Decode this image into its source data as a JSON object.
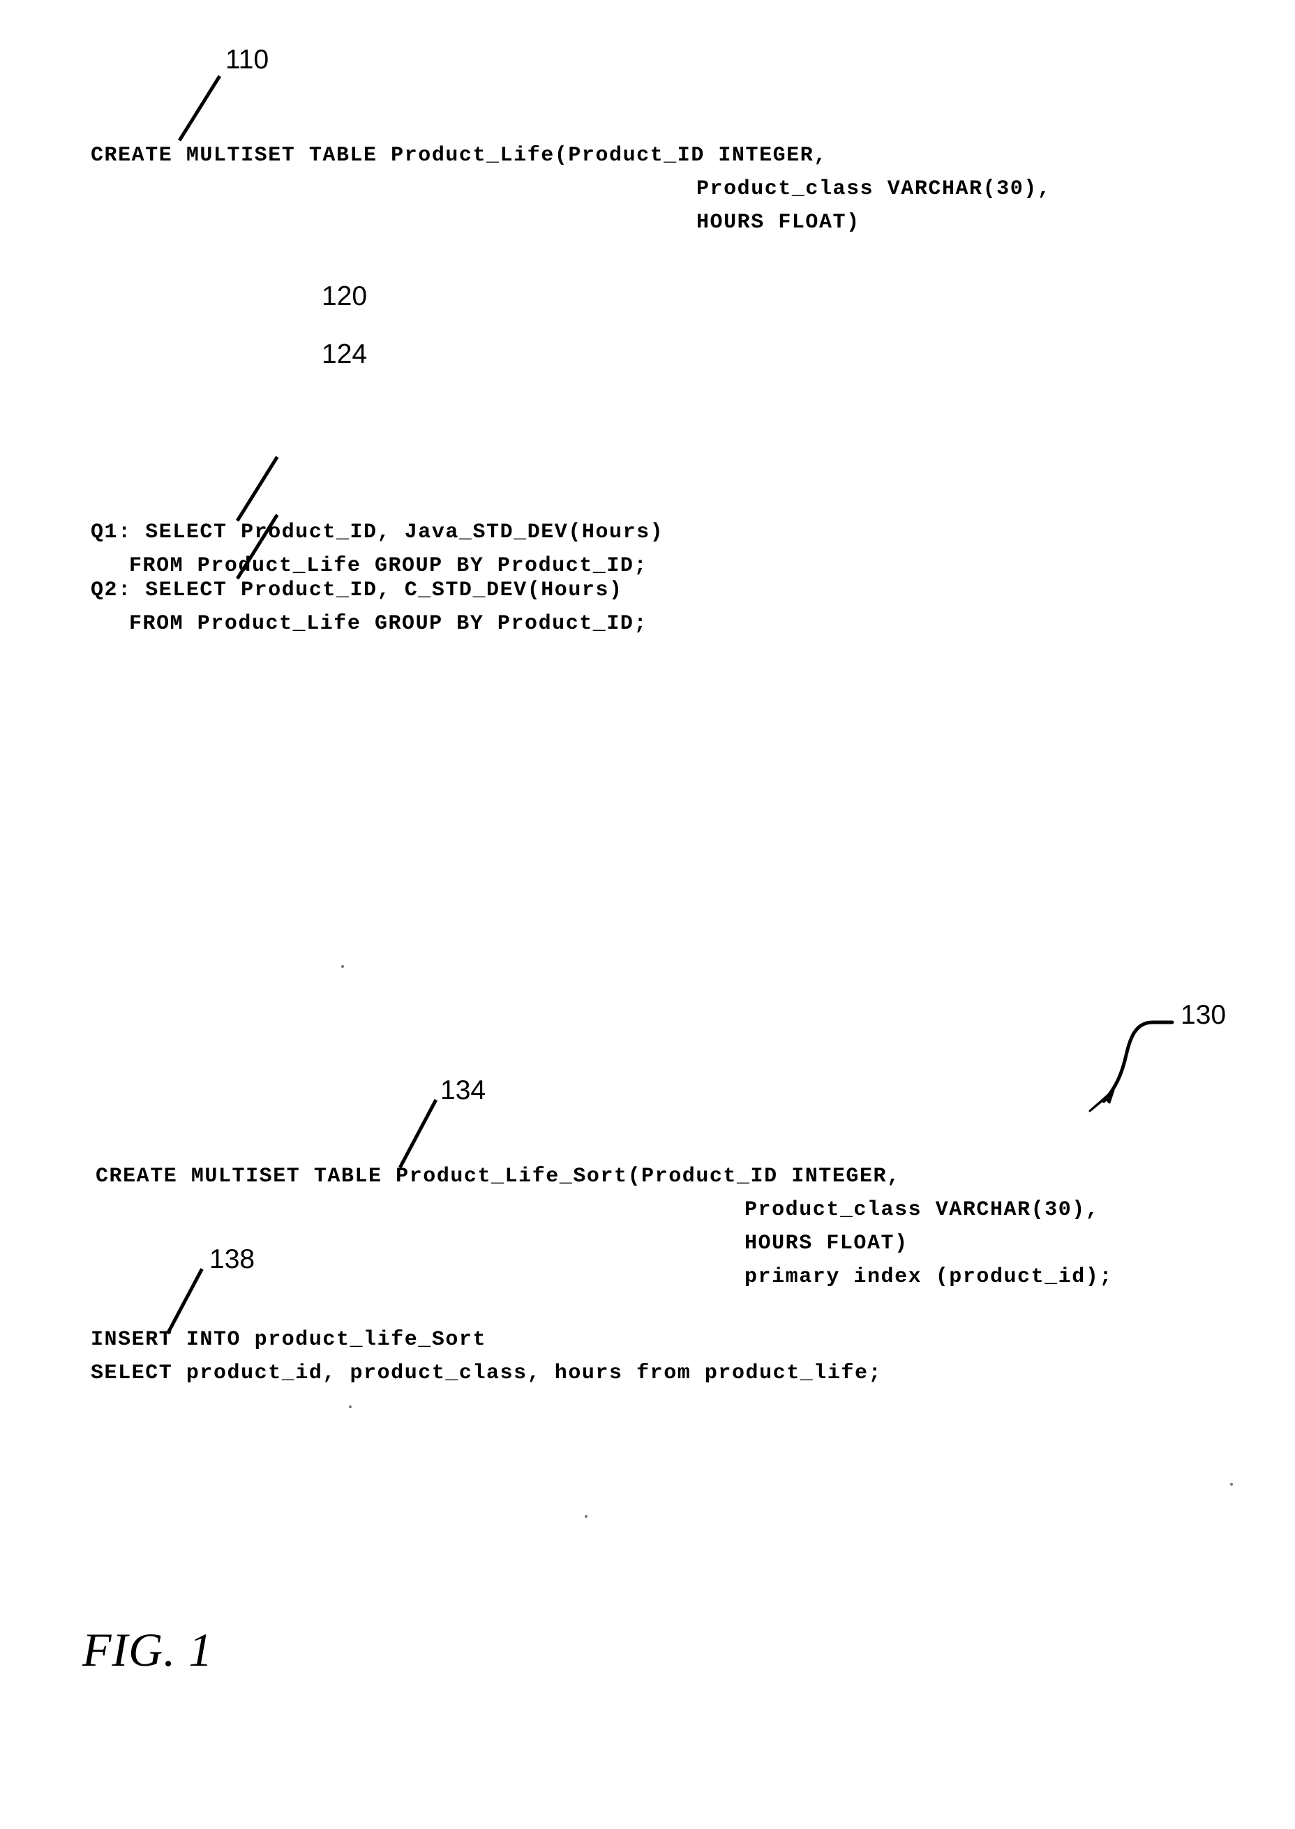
{
  "figure": {
    "caption": "FIG. 1",
    "page_background": "#ffffff",
    "ink_color": "#000000"
  },
  "blocks": [
    {
      "id": "create-product-life",
      "reference_numeral": "110",
      "lines": [
        "CREATE MULTISET TABLE Product_Life(Product_ID INTEGER,",
        "Product_class VARCHAR(30),",
        "HOURS FLOAT)"
      ]
    },
    {
      "id": "query-q1",
      "reference_numeral": "120",
      "lines": [
        "Q1: SELECT Product_ID, Java_STD_DEV(Hours)",
        "FROM Product_Life GROUP BY Product_ID;"
      ]
    },
    {
      "id": "query-q2",
      "reference_numeral": "124",
      "lines": [
        "Q2: SELECT Product_ID, C_STD_DEV(Hours)",
        "FROM Product_Life GROUP BY Product_ID;"
      ]
    },
    {
      "id": "create-product-life-sort",
      "reference_numeral": "134",
      "group_reference_numeral": "130",
      "lines": [
        "CREATE MULTISET TABLE Product_Life_Sort(Product_ID INTEGER,",
        "Product_class VARCHAR(30),",
        "HOURS FLOAT)",
        "primary index (product_id);"
      ]
    },
    {
      "id": "insert-into-sort",
      "reference_numeral": "138",
      "lines": [
        "INSERT INTO product_life_Sort",
        "SELECT product_id, product_class, hours from product_life;"
      ]
    }
  ],
  "code": {
    "block1": {
      "line1": "CREATE MULTISET TABLE Product_Life(Product_ID INTEGER,",
      "line2": "Product_class VARCHAR(30),",
      "line3": "HOURS FLOAT)"
    },
    "block2": {
      "q1_line1": "Q1: SELECT Product_ID, Java_STD_DEV(Hours)",
      "q1_line2": "FROM Product_Life GROUP BY Product_ID;",
      "q2_line1": "Q2: SELECT Product_ID, C_STD_DEV(Hours)",
      "q2_line2": "FROM Product_Life GROUP BY Product_ID;"
    },
    "block3": {
      "line1": "CREATE MULTISET TABLE Product_Life_Sort(Product_ID INTEGER,",
      "line2": "Product_class VARCHAR(30),",
      "line3": "HOURS FLOAT)",
      "line4": "primary index (product_id);"
    },
    "block4": {
      "line1": "INSERT INTO product_life_Sort",
      "line2": "SELECT product_id, product_class, hours from product_life;"
    }
  },
  "refs": {
    "r110": "110",
    "r120": "120",
    "r124": "124",
    "r130": "130",
    "r134": "134",
    "r138": "138"
  }
}
